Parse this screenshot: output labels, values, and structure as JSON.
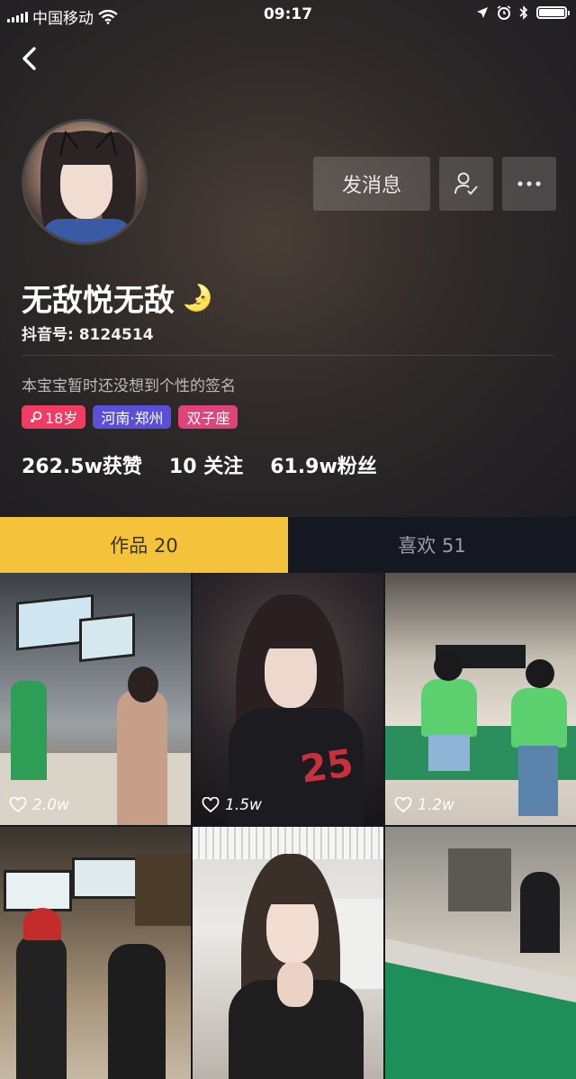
{
  "status_bar": {
    "carrier": "中国移动",
    "time": "09:17"
  },
  "profile": {
    "name": "无敌悦无敌",
    "name_emoji": "🌛",
    "douyin_id": "抖音号: 8124514",
    "signature": "本宝宝暂时还没想到个性的签名",
    "tags": {
      "age": "18岁",
      "location": "河南·郑州",
      "zodiac": "双子座"
    },
    "stats": {
      "likes": "262.5w获赞",
      "following": "10 关注",
      "followers": "61.9w粉丝"
    }
  },
  "actions": {
    "message_label": "发消息"
  },
  "tabs": {
    "works": "作品 20",
    "liked": "喜欢 51"
  },
  "videos": [
    {
      "likes": "2.0w"
    },
    {
      "likes": "1.5w"
    },
    {
      "likes": "1.2w"
    },
    {
      "likes": ""
    },
    {
      "likes": ""
    },
    {
      "likes": ""
    }
  ],
  "colors": {
    "active_tab": "#f5c33b",
    "age_tag": "#f03c63",
    "location_tag": "#5b4ed8",
    "zodiac_tag": "#e0427b"
  }
}
